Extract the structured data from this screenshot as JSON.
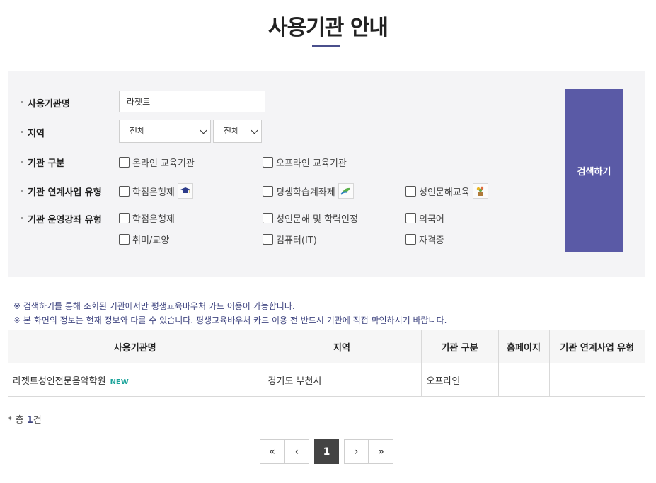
{
  "page": {
    "title": "사용기관 안내"
  },
  "search": {
    "name_label": "사용기관명",
    "name_value": "라젯트",
    "region_label": "지역",
    "region1_value": "전체",
    "region2_value": "전체",
    "type_label": "기관 구분",
    "type_options": [
      "온라인 교육기관",
      "오프라인 교육기관"
    ],
    "program_label": "기관 연계사업 유형",
    "program_options": [
      "학점은행제",
      "평생학습계좌제",
      "성인문해교육"
    ],
    "course_label": "기관 운영강좌 유형",
    "course_options": [
      "학점은행제",
      "성인문해 및 학력인정",
      "외국어",
      "취미/교양",
      "컴퓨터(IT)",
      "자격증"
    ],
    "button_label": "검색하기"
  },
  "notices": [
    "※ 검색하기를 통해 조회된 기관에서만 평생교육바우처 카드 이용이 가능합니다.",
    "※ 본 화면의 정보는 현재 정보와 다를 수 있습니다. 평생교육바우처 카드 이용 전 반드시 기관에 직접 확인하시기 바랍니다."
  ],
  "table": {
    "headers": [
      "사용기관명",
      "지역",
      "기관 구분",
      "홈페이지",
      "기관 연계사업 유형"
    ],
    "rows": [
      {
        "name": "라젯트성인전문음악학원",
        "badge": "NEW",
        "region": "경기도 부천시",
        "type": "오프라인",
        "homepage": "",
        "program": ""
      }
    ]
  },
  "total": {
    "prefix": "* 총 ",
    "count": "1",
    "suffix": "건"
  },
  "pagination": {
    "first": "«",
    "prev": "‹",
    "current": "1",
    "next": "›",
    "last": "»"
  },
  "icons": {
    "program_icons": [
      "graduation-cap-icon",
      "leaf-icon",
      "flower-pot-icon"
    ]
  },
  "colors": {
    "accent": "#5a5aa6",
    "notice": "#3f4580",
    "new_badge": "#1aa39a"
  }
}
